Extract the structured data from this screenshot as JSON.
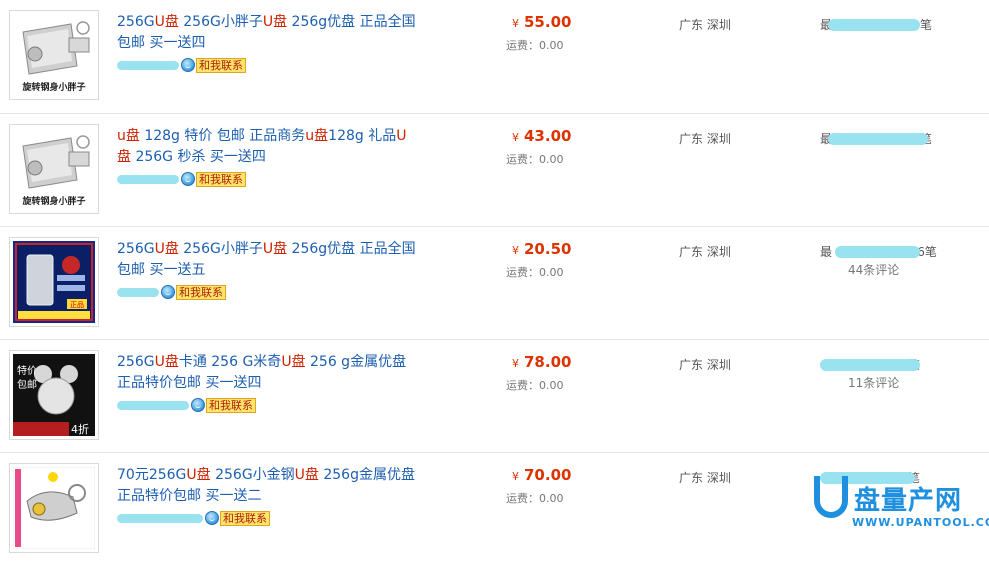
{
  "items": [
    {
      "title_parts": [
        {
          "text": "256G",
          "hl": false
        },
        {
          "text": "U盘",
          "hl": true
        },
        {
          "text": " 256G小胖子",
          "hl": false
        },
        {
          "text": "U盘",
          "hl": true
        },
        {
          "text": " 256g优盘 正品全国包邮 买一送四",
          "hl": false
        }
      ],
      "thumb_caption": "旋转钢身小胖子",
      "contact_label": "和我联系",
      "currency": "¥",
      "price": "55.00",
      "shipping": "运费：0.00",
      "location": "广东 深圳",
      "sales_prefix": "最",
      "sales_suffix": "笔",
      "comments": ""
    },
    {
      "title_parts": [
        {
          "text": "u盘",
          "hl": true
        },
        {
          "text": " 128g 特价 包邮 正品商务",
          "hl": false
        },
        {
          "text": "u盘",
          "hl": true
        },
        {
          "text": "128g 礼品",
          "hl": false
        },
        {
          "text": "U盘",
          "hl": true
        },
        {
          "text": " 256G 秒杀 买一送四",
          "hl": false
        }
      ],
      "thumb_caption": "旋转钢身小胖子",
      "contact_label": "和我联系",
      "currency": "¥",
      "price": "43.00",
      "shipping": "运费：0.00",
      "location": "广东 深圳",
      "sales_prefix": "最",
      "sales_suffix": "笔",
      "comments": ""
    },
    {
      "title_parts": [
        {
          "text": "256G",
          "hl": false
        },
        {
          "text": "U盘",
          "hl": true
        },
        {
          "text": " 256G小胖子",
          "hl": false
        },
        {
          "text": "U盘",
          "hl": true
        },
        {
          "text": " 256g优盘 正品全国包邮 买一送五",
          "hl": false
        }
      ],
      "thumb_caption": "正品",
      "contact_label": "和我联系",
      "currency": "¥",
      "price": "20.50",
      "shipping": "运费：0.00",
      "location": "广东 深圳",
      "sales_prefix": "最",
      "sales_suffix": "116笔",
      "comments": "44条评论"
    },
    {
      "title_parts": [
        {
          "text": "256G",
          "hl": false
        },
        {
          "text": "U盘",
          "hl": true
        },
        {
          "text": "卡通 256 G米奇",
          "hl": false
        },
        {
          "text": "U盘",
          "hl": true
        },
        {
          "text": " 256 g金属优盘 正品特价包邮 买一送四",
          "hl": false
        }
      ],
      "thumb_caption": "特价包邮 4折",
      "contact_label": "和我联系",
      "currency": "¥",
      "price": "78.00",
      "shipping": "运费：0.00",
      "location": "广东 深圳",
      "sales_prefix": "",
      "sales_suffix": "笔",
      "comments": "11条评论"
    },
    {
      "title_parts": [
        {
          "text": "70元256G",
          "hl": false
        },
        {
          "text": "U盘",
          "hl": true
        },
        {
          "text": " 256G小金钢",
          "hl": false
        },
        {
          "text": "U盘",
          "hl": true
        },
        {
          "text": " 256g金属优盘 正品特价包邮 买一送二",
          "hl": false
        }
      ],
      "thumb_caption": "",
      "contact_label": "和我联系",
      "currency": "¥",
      "price": "70.00",
      "shipping": "运费：0.00",
      "location": "广东 深圳",
      "sales_prefix": "",
      "sales_suffix": "笔",
      "comments": ""
    }
  ],
  "watermark": {
    "logo_text": "盘量产网",
    "url": "WWW.UPANTOOL.COM"
  }
}
